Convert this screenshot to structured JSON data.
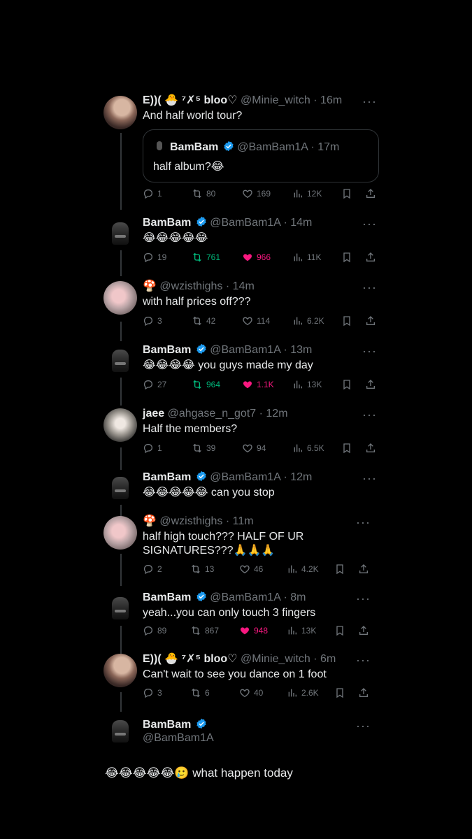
{
  "colors": {
    "background": "#000000",
    "text": "#e7e9ea",
    "muted": "#71767b",
    "verified": "#1d9bf0",
    "retweet_active": "#00ba7c",
    "like_active": "#f91880"
  },
  "thread": [
    {
      "display_name": "E))( 🐣 ⁷✗⁵ bloo♡",
      "handle": "@Minie_witch",
      "time": "16m",
      "text": "And half world tour?",
      "quote": {
        "name": "BamBam",
        "handle": "@BamBam1A",
        "time": "17m",
        "text": "half album?😂"
      },
      "stats": {
        "replies": "1",
        "retweets": "80",
        "likes": "169",
        "views": "12K"
      }
    },
    {
      "display_name": "BamBam",
      "verified": true,
      "handle": "@BamBam1A",
      "time": "14m",
      "text": "😂😂😂😂😂",
      "stats": {
        "replies": "19",
        "retweets": "761",
        "likes": "966",
        "views": "11K"
      }
    },
    {
      "display_name": "🍄",
      "handle": "@wzisthighs",
      "time": "14m",
      "text": "with half prices off???",
      "stats": {
        "replies": "3",
        "retweets": "42",
        "likes": "114",
        "views": "6.2K"
      }
    },
    {
      "display_name": "BamBam",
      "verified": true,
      "handle": "@BamBam1A",
      "time": "13m",
      "text": "😂😂😂😂 you guys made my day",
      "stats": {
        "replies": "27",
        "retweets": "964",
        "likes": "1.1K",
        "views": "13K"
      }
    },
    {
      "display_name": "jaee",
      "handle": "@ahgase_n_got7",
      "time": "12m",
      "text": "Half the members?",
      "stats": {
        "replies": "1",
        "retweets": "39",
        "likes": "94",
        "views": "6.5K"
      }
    },
    {
      "display_name": "BamBam",
      "verified": true,
      "handle": "@BamBam1A",
      "time": "12m",
      "text": "😂😂😂😂😂 can you stop"
    },
    {
      "display_name": "🍄",
      "handle": "@wzisthighs",
      "time": "11m",
      "text_line1": "half high touch??? HALF OF UR",
      "text_line2": "SIGNATURES???🙏🙏🙏",
      "stats": {
        "replies": "2",
        "retweets": "13",
        "likes": "46",
        "views": "4.2K"
      }
    },
    {
      "display_name": "BamBam",
      "verified": true,
      "handle": "@BamBam1A",
      "time": "8m",
      "text": "yeah...you can only touch 3 fingers",
      "stats": {
        "replies": "89",
        "retweets": "867",
        "likes": "948",
        "views": "13K"
      }
    },
    {
      "display_name": "E))( 🐣 ⁷✗⁵ bloo♡",
      "handle": "@Minie_witch",
      "time": "6m",
      "text": "Can't wait to see you dance on 1 foot",
      "stats": {
        "replies": "3",
        "retweets": "6",
        "likes": "40",
        "views": "2.6K"
      }
    },
    {
      "display_name": "BamBam",
      "verified": true,
      "handle": "@BamBam1A"
    }
  ],
  "final_tweet": {
    "text": "😂😂😂😂😂🥲 what happen today"
  },
  "icons": [
    "reply-icon",
    "retweet-icon",
    "like-icon",
    "views-icon",
    "bookmark-icon",
    "share-icon",
    "more-icon",
    "verified-badge-icon"
  ]
}
